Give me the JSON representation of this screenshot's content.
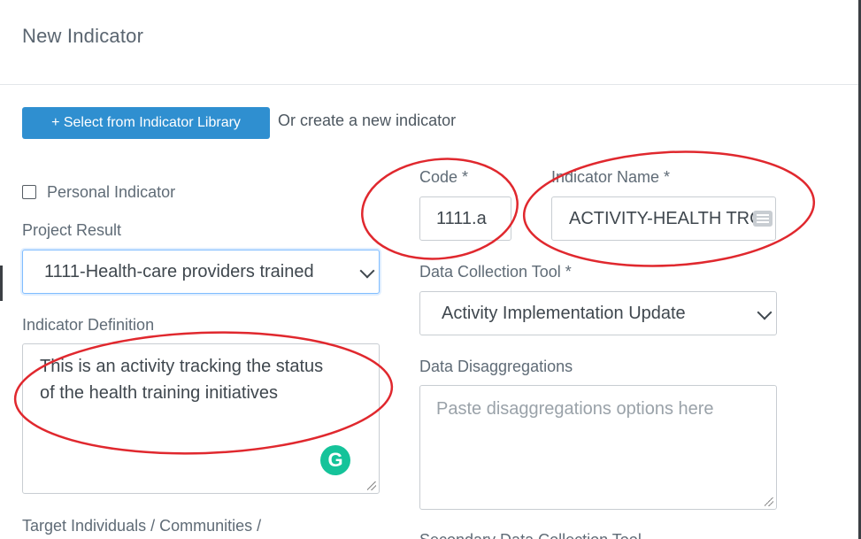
{
  "modal": {
    "title": "New Indicator"
  },
  "toolbar": {
    "library_button_label": "+ Select from Indicator Library",
    "or_create_text": "Or create a new indicator"
  },
  "form": {
    "personal_indicator_label": "Personal Indicator",
    "project_result_label": "Project Result",
    "project_result_value": "1111-Health-care providers trained",
    "indicator_definition_label": "Indicator Definition",
    "indicator_definition_line1": "This is an activity tracking the status",
    "indicator_definition_line2": "of the health training initiatives",
    "target_label": "Target Individuals / Communities /",
    "code_label": "Code *",
    "code_value": "1111.a",
    "indicator_name_label": "Indicator Name *",
    "indicator_name_value": "ACTIVITY-HEALTH TRG",
    "data_collection_tool_label": "Data Collection Tool *",
    "data_collection_tool_value": "Activity Implementation Update",
    "data_disaggregations_label": "Data Disaggregations",
    "data_disaggregations_placeholder": "Paste disaggregations options here",
    "secondary_tool_label": "Secondary Data Collection Tool"
  },
  "icons": {
    "grammarly": "grammarly-icon",
    "grammarly_glyph": "G",
    "list": "list-icon",
    "chevron": "chevron-down-icon"
  },
  "colors": {
    "primary_button": "#2f8fd0",
    "annotation_ellipse": "#e0282e",
    "grammarly": "#15c39a"
  }
}
